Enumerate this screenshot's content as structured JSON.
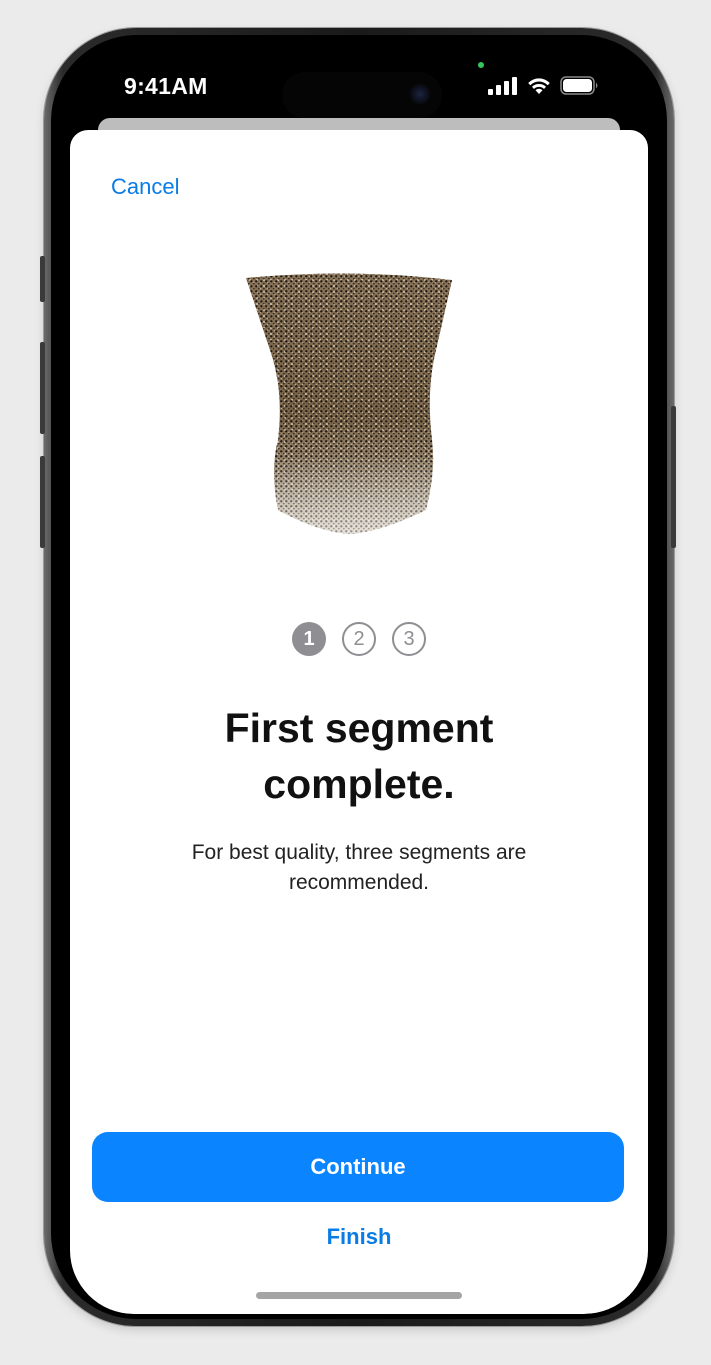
{
  "status_bar": {
    "time": "9:41AM",
    "icons": [
      "signal-icon",
      "wifi-icon",
      "battery-icon"
    ]
  },
  "nav": {
    "cancel_label": "Cancel"
  },
  "scan": {
    "icon": "point-cloud-scan"
  },
  "progress": {
    "steps": [
      "1",
      "2",
      "3"
    ],
    "current_step": 1
  },
  "content": {
    "title_line1": "First segment",
    "title_line2": "complete.",
    "subtitle_line1": "For best quality, three segments are",
    "subtitle_line2": "recommended."
  },
  "actions": {
    "continue_label": "Continue",
    "finish_label": "Finish"
  },
  "colors": {
    "accent": "#0a84ff",
    "link": "#0a7ce6",
    "step_gray": "#8e8e93"
  }
}
